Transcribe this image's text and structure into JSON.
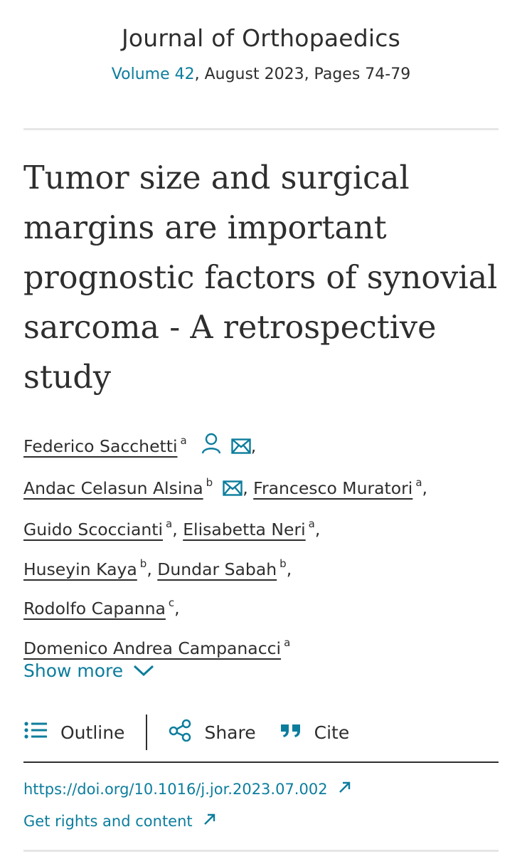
{
  "journal": {
    "name": "Journal of Orthopaedics",
    "volume": "Volume 42",
    "date_pages": ", August 2023, Pages 74-79"
  },
  "article": {
    "title": "Tumor size and surgical margins are important prognostic factors of synovial sarcoma - A retrospective study"
  },
  "authors": [
    {
      "name": "Federico Sacchetti",
      "aff": "a"
    },
    {
      "name": "Andac Celasun Alsina",
      "aff": "b"
    },
    {
      "name": "Francesco Muratori",
      "aff": "a"
    },
    {
      "name": "Guido Scoccianti",
      "aff": "a"
    },
    {
      "name": "Elisabetta Neri",
      "aff": "a"
    },
    {
      "name": "Huseyin Kaya",
      "aff": "b"
    },
    {
      "name": "Dundar Sabah",
      "aff": "b"
    },
    {
      "name": "Rodolfo Capanna",
      "aff": "c"
    },
    {
      "name": "Domenico Andrea Campanacci",
      "aff": "a"
    }
  ],
  "show_more": "Show more",
  "toolbar": {
    "outline": "Outline",
    "share": "Share",
    "cite": "Cite"
  },
  "links": {
    "doi": "https://doi.org/10.1016/j.jor.2023.07.002",
    "rights": "Get rights and content"
  },
  "colors": {
    "accent": "#0c7d9d",
    "text": "#2e2e2e"
  },
  "icons": {
    "author_profile": "person-icon",
    "email": "envelope-icon",
    "show_more": "chevron-down-icon",
    "outline": "list-icon",
    "share": "share-icon",
    "cite": "quote-icon",
    "external": "arrow-up-right-icon"
  }
}
